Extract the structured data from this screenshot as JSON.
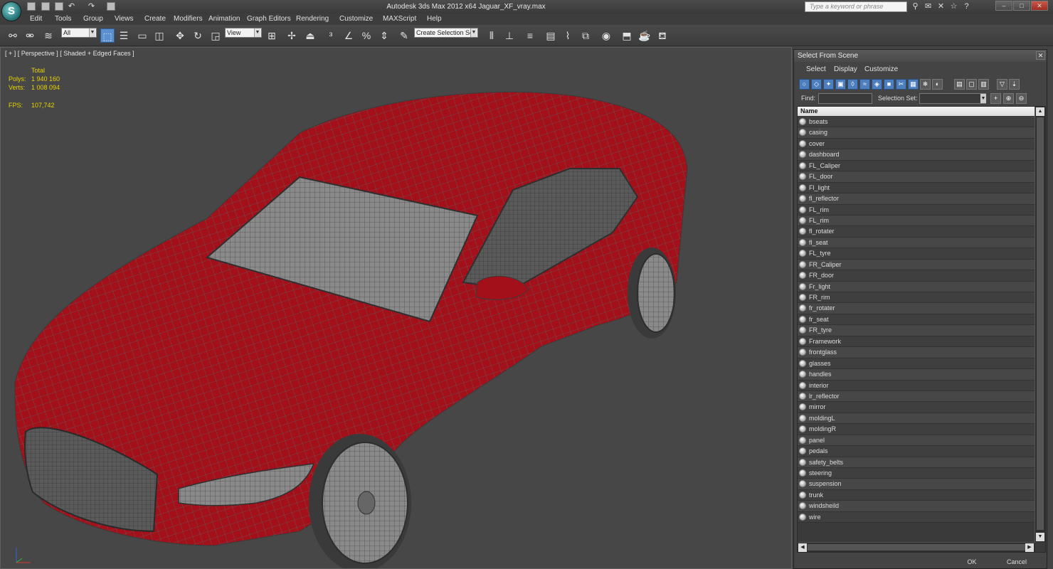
{
  "app": {
    "logo_letter": "S",
    "window_title": "Autodesk 3ds Max  2012 x64        Jaguar_XF_vray.max",
    "search_placeholder": "Type a keyword or phrase"
  },
  "menu": [
    "Edit",
    "Tools",
    "Group",
    "Views",
    "Create",
    "Modifiers",
    "Animation",
    "Graph Editors",
    "Rendering",
    "Customize",
    "MAXScript",
    "Help"
  ],
  "toolbar": {
    "selection_filter": "All",
    "reference_coord": "View",
    "named_selection": "Create Selection Se"
  },
  "viewport": {
    "label": "[ + ] [ Perspective ] [ Shaded + Edged Faces ]",
    "stats_header": "Total",
    "polys_label": "Polys:",
    "polys_value": "1 940 160",
    "verts_label": "Verts:",
    "verts_value": "1 008 094",
    "fps_label": "FPS:",
    "fps_value": "107,742",
    "colors": {
      "car_body": "#a3101a",
      "wire": "#5e5e5e",
      "background": "#474747"
    }
  },
  "dialog": {
    "title": "Select From Scene",
    "menu": [
      "Select",
      "Display",
      "Customize"
    ],
    "find_label": "Find:",
    "find_value": "",
    "selection_set_label": "Selection Set:",
    "selection_set_value": "",
    "column_header": "Name",
    "objects": [
      "bseats",
      "casing",
      "cover",
      "dashboard",
      "FL_Caliper",
      "FL_door",
      "Fl_light",
      "fl_reflector",
      "FL_rim",
      "FL_rim",
      "fl_rotater",
      "fl_seat",
      "FL_tyre",
      "FR_Caliper",
      "FR_door",
      "Fr_light",
      "FR_rim",
      "fr_rotater",
      "fr_seat",
      "FR_tyre",
      "Framework",
      "frontglass",
      "glasses",
      "handles",
      "interior",
      "lr_reflector",
      "mirror",
      "moldingL",
      "moldingR",
      "panel",
      "pedals",
      "safety_belts",
      "steering",
      "suspension",
      "trunk",
      "windsheild",
      "wire"
    ],
    "ok_label": "OK",
    "cancel_label": "Cancel"
  }
}
